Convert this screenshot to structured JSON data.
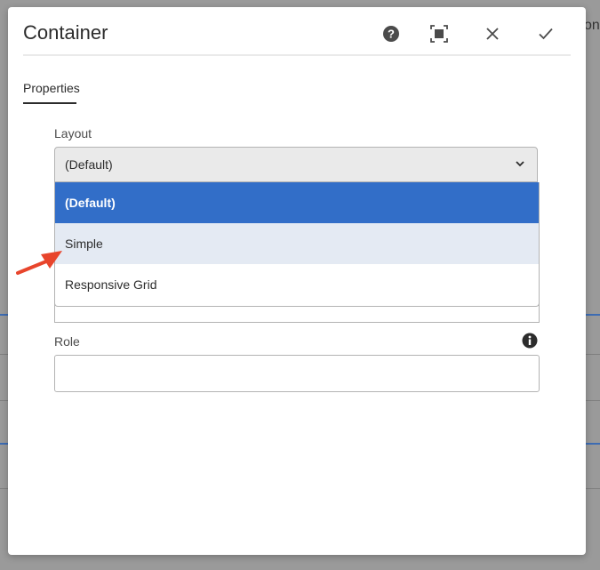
{
  "background": {
    "partial_text": "on'"
  },
  "dialog": {
    "title": "Container",
    "header_icons": [
      "help-icon",
      "fullscreen-icon",
      "close-icon",
      "check-icon"
    ]
  },
  "tabs": [
    {
      "label": "Properties",
      "active": true
    }
  ],
  "layout_field": {
    "label": "Layout",
    "value": "(Default)",
    "options": [
      {
        "label": "(Default)",
        "state": "selected"
      },
      {
        "label": "Simple",
        "state": "hover"
      },
      {
        "label": "Responsive Grid",
        "state": "normal"
      }
    ]
  },
  "role_field": {
    "label": "Role",
    "value": ""
  },
  "colors": {
    "selected_option": "#326ec8",
    "hover_option": "#e4eaf3",
    "annotation_arrow": "#e8452c"
  }
}
